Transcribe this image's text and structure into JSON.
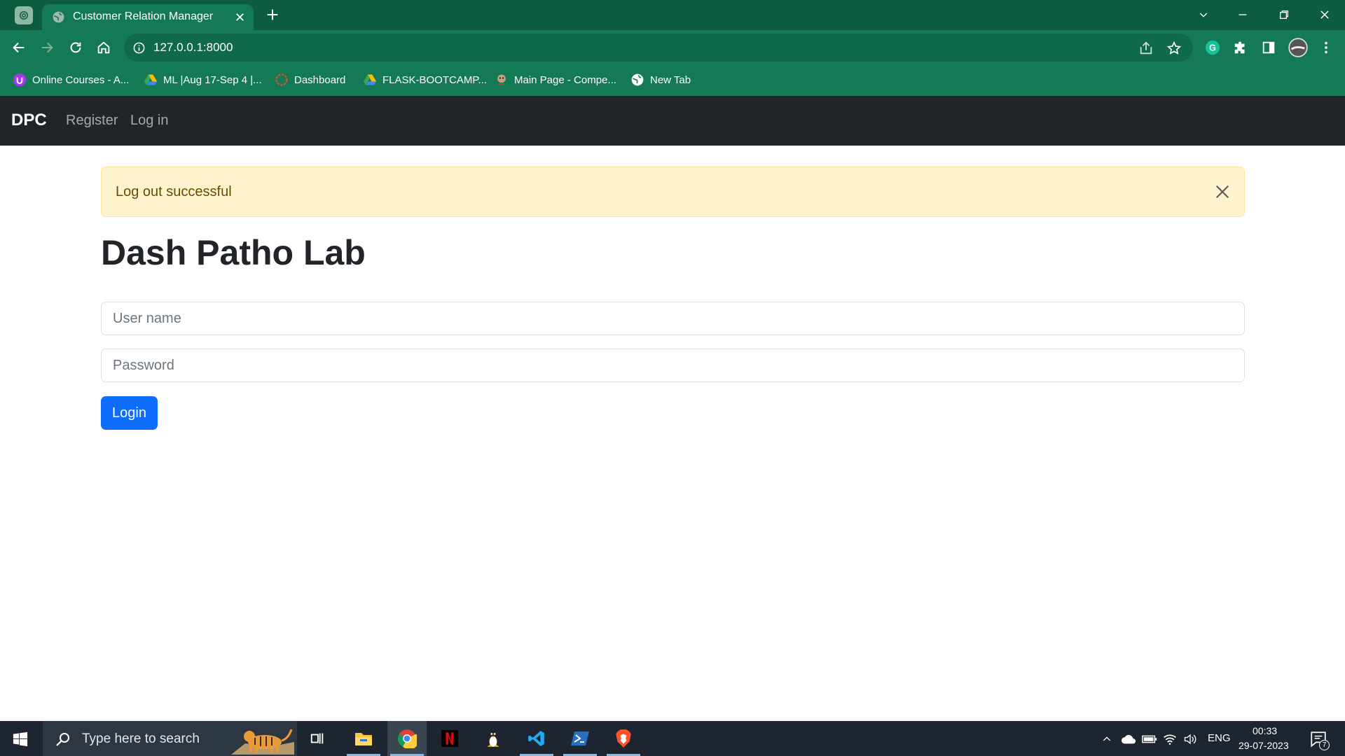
{
  "browser": {
    "tab_title": "Customer Relation Manager",
    "url": "127.0.0.1:8000",
    "bookmarks": [
      {
        "label": "Online Courses - A...",
        "icon": "udemy-icon"
      },
      {
        "label": "ML |Aug 17-Sep 4 |...",
        "icon": "google-drive-icon"
      },
      {
        "label": "Dashboard",
        "icon": "dashboard-ring-icon"
      },
      {
        "label": "FLASK-BOOTCAMP...",
        "icon": "google-drive-icon"
      },
      {
        "label": "Main Page - Compe...",
        "icon": "wiki-icon"
      },
      {
        "label": "New Tab",
        "icon": "globe-icon"
      }
    ],
    "theme_colors": {
      "tabstrip": "#0d5c3f",
      "toolbar": "#147a55"
    }
  },
  "navbar": {
    "brand": "DPC",
    "links": [
      "Register",
      "Log in"
    ]
  },
  "alert": {
    "message": "Log out successful",
    "color": "#fff3cd"
  },
  "main": {
    "heading": "Dash Patho Lab",
    "username_placeholder": "User name",
    "password_placeholder": "Password",
    "login_label": "Login",
    "accent": "#0d6efd"
  },
  "taskbar": {
    "search_placeholder": "Type here to search",
    "apps": [
      "task-view",
      "file-explorer",
      "chrome",
      "netflix",
      "linux",
      "vscode",
      "powershell",
      "brave"
    ],
    "language": "ENG",
    "time": "00:33",
    "date": "29-07-2023",
    "notification_count": "7"
  }
}
